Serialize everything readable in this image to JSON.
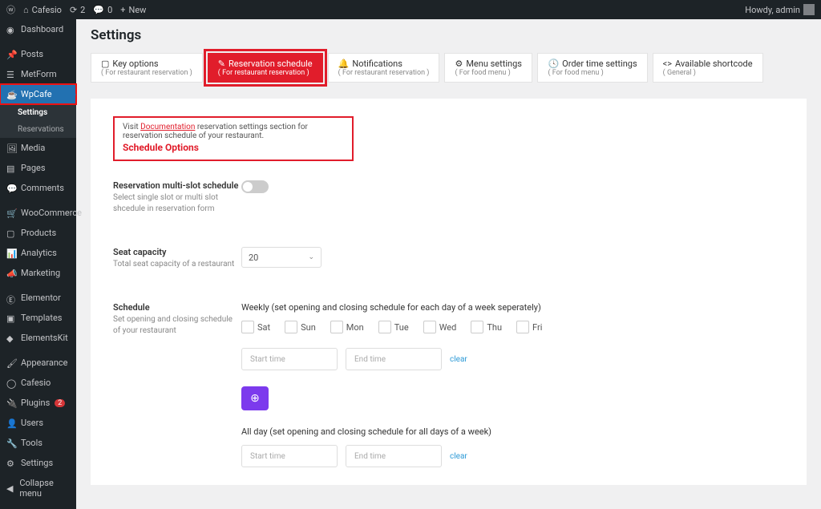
{
  "adminbar": {
    "site": "Cafesio",
    "updates": "2",
    "comments": "0",
    "new": "New",
    "howdy": "Howdy, admin"
  },
  "sidebar": {
    "items": [
      {
        "label": "Dashboard"
      },
      {
        "label": "Posts"
      },
      {
        "label": "MetForm"
      },
      {
        "label": "WpCafe"
      },
      {
        "label": "Media"
      },
      {
        "label": "Pages"
      },
      {
        "label": "Comments"
      },
      {
        "label": "WooCommerce"
      },
      {
        "label": "Products"
      },
      {
        "label": "Analytics"
      },
      {
        "label": "Marketing"
      },
      {
        "label": "Elementor"
      },
      {
        "label": "Templates"
      },
      {
        "label": "ElementsKit"
      },
      {
        "label": "Appearance"
      },
      {
        "label": "Cafesio"
      },
      {
        "label": "Plugins"
      },
      {
        "label": "Users"
      },
      {
        "label": "Tools"
      },
      {
        "label": "Settings"
      },
      {
        "label": "Collapse menu"
      }
    ],
    "submenu": {
      "settings": "Settings",
      "reservations": "Reservations"
    },
    "plugin_badge": "2"
  },
  "page": {
    "title": "Settings"
  },
  "tabs": [
    {
      "label": "Key options",
      "sub": "( For restaurant reservation )"
    },
    {
      "label": "Reservation schedule",
      "sub": "( For restaurant reservation )"
    },
    {
      "label": "Notifications",
      "sub": "( For restaurant reservation )"
    },
    {
      "label": "Menu settings",
      "sub": "( For food menu )"
    },
    {
      "label": "Order time settings",
      "sub": "( For food menu )"
    },
    {
      "label": "Available shortcode",
      "sub": "( General )"
    }
  ],
  "docbox": {
    "visit_pre": "Visit ",
    "visit_link": "Documentation",
    "visit_post": " reservation settings section for reservation schedule of your restaurant.",
    "title": "Schedule Options"
  },
  "form": {
    "multi": {
      "title": "Reservation multi-slot schedule",
      "desc": "Select single slot or multi slot shcedule in reservation form"
    },
    "seat": {
      "title": "Seat capacity",
      "desc": "Total seat capacity of a restaurant",
      "value": "20"
    },
    "sched": {
      "title": "Schedule",
      "desc": "Set opening and closing schedule of your restaurant"
    },
    "weekly_head": "Weekly (set opening and closing schedule for each day of a week seperately)",
    "days": [
      "Sat",
      "Sun",
      "Mon",
      "Tue",
      "Wed",
      "Thu",
      "Fri"
    ],
    "start_ph": "Start time",
    "end_ph": "End time",
    "clear": "clear",
    "allday_head": "All day (set opening and closing schedule for all days of a week)"
  }
}
